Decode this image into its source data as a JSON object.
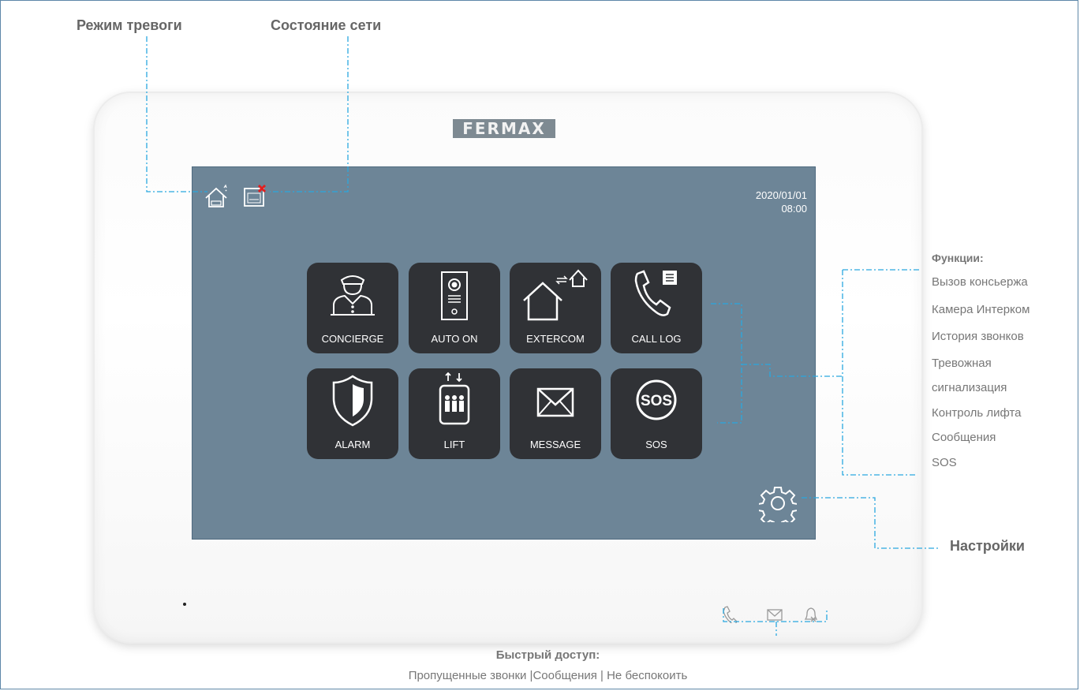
{
  "annotations": {
    "alarm_mode": "Режим тревоги",
    "network_status": "Состояние сети",
    "functions_title": "Функции:",
    "functions": [
      "Вызов консьержа",
      "Камера Интерком",
      "История звонков",
      "Тревожная",
      "сигнализация",
      "Контроль лифта",
      "Сообщения",
      "SOS"
    ],
    "settings": "Настройки",
    "quick_access_title": "Быстрый доступ:",
    "quick_access_items": "Пропущенные звонки |Сообщения | Не беспокоить"
  },
  "device": {
    "brand": "FERMAX",
    "date": "2020/01/01",
    "time": "08:00",
    "tiles_row1": [
      {
        "label": "CONCIERGE",
        "icon": "concierge-icon"
      },
      {
        "label": "AUTO ON",
        "icon": "door-panel-icon"
      },
      {
        "label": "EXTERCOM",
        "icon": "house-transfer-icon"
      },
      {
        "label": "CALL LOG",
        "icon": "phone-log-icon"
      }
    ],
    "tiles_row2": [
      {
        "label": "ALARM",
        "icon": "shield-icon"
      },
      {
        "label": "LIFT",
        "icon": "elevator-icon"
      },
      {
        "label": "MESSAGE",
        "icon": "envelope-icon"
      },
      {
        "label": "SOS",
        "icon": "sos-icon"
      }
    ],
    "status_icons": [
      "house-alarm-icon",
      "network-disconnected-icon"
    ],
    "quick_icons": [
      "missed-call-icon",
      "message-icon",
      "do-not-disturb-icon"
    ]
  },
  "colors": {
    "screen": "#6d8597",
    "tile": "#303236",
    "leader_line": "#2aa8e0",
    "frame_border": "#5e87a8",
    "disconnect_x": "#e02020"
  }
}
